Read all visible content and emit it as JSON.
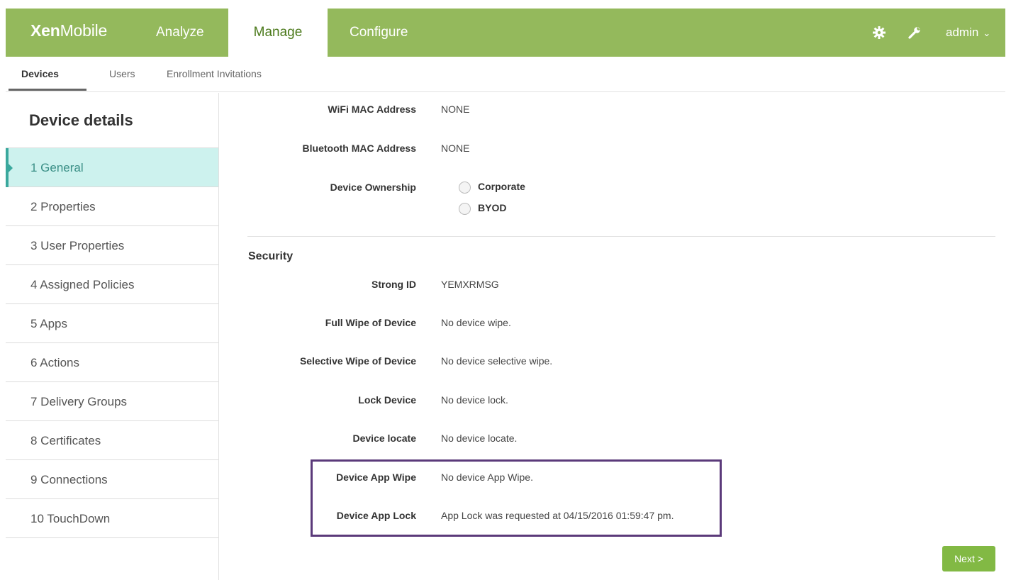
{
  "app": {
    "logo_bold": "Xen",
    "logo_light": "Mobile"
  },
  "topnav": {
    "items": [
      {
        "label": "Analyze"
      },
      {
        "label": "Manage"
      },
      {
        "label": "Configure"
      }
    ],
    "user": "admin",
    "icons": [
      "gear-icon",
      "wrench-icon",
      "chevron-down-icon"
    ]
  },
  "subnav": {
    "tabs": [
      {
        "label": "Devices"
      },
      {
        "label": "Users"
      },
      {
        "label": "Enrollment Invitations"
      }
    ]
  },
  "sidebar": {
    "title": "Device details",
    "steps": [
      {
        "label": "1  General"
      },
      {
        "label": "2  Properties"
      },
      {
        "label": "3  User Properties"
      },
      {
        "label": "4  Assigned Policies"
      },
      {
        "label": "5  Apps"
      },
      {
        "label": "6  Actions"
      },
      {
        "label": "7  Delivery Groups"
      },
      {
        "label": "8  Certificates"
      },
      {
        "label": "9  Connections"
      },
      {
        "label": "10  TouchDown"
      }
    ]
  },
  "details": {
    "wifi_mac_label": "WiFi MAC Address",
    "wifi_mac_value": "NONE",
    "bt_mac_label": "Bluetooth MAC Address",
    "bt_mac_value": "NONE",
    "ownership_label": "Device Ownership",
    "ownership_options": [
      "Corporate",
      "BYOD"
    ]
  },
  "security": {
    "title": "Security",
    "rows": [
      {
        "label": "Strong ID",
        "value": "YEMXRMSG"
      },
      {
        "label": "Full Wipe of Device",
        "value": "No device wipe."
      },
      {
        "label": "Selective Wipe of Device",
        "value": "No device selective wipe."
      },
      {
        "label": "Lock Device",
        "value": "No device lock."
      },
      {
        "label": "Device locate",
        "value": "No device locate."
      },
      {
        "label": "Device App Wipe",
        "value": "No device App Wipe."
      },
      {
        "label": "Device App Lock",
        "value": "App Lock was requested at 04/15/2016 01:59:47 pm."
      }
    ]
  },
  "footer": {
    "next_label": "Next >"
  },
  "colors": {
    "brand_green": "#94b95c",
    "active_step_bg": "#cdf2ee",
    "highlight_border": "#5b3a7a",
    "next_button": "#82b944"
  }
}
